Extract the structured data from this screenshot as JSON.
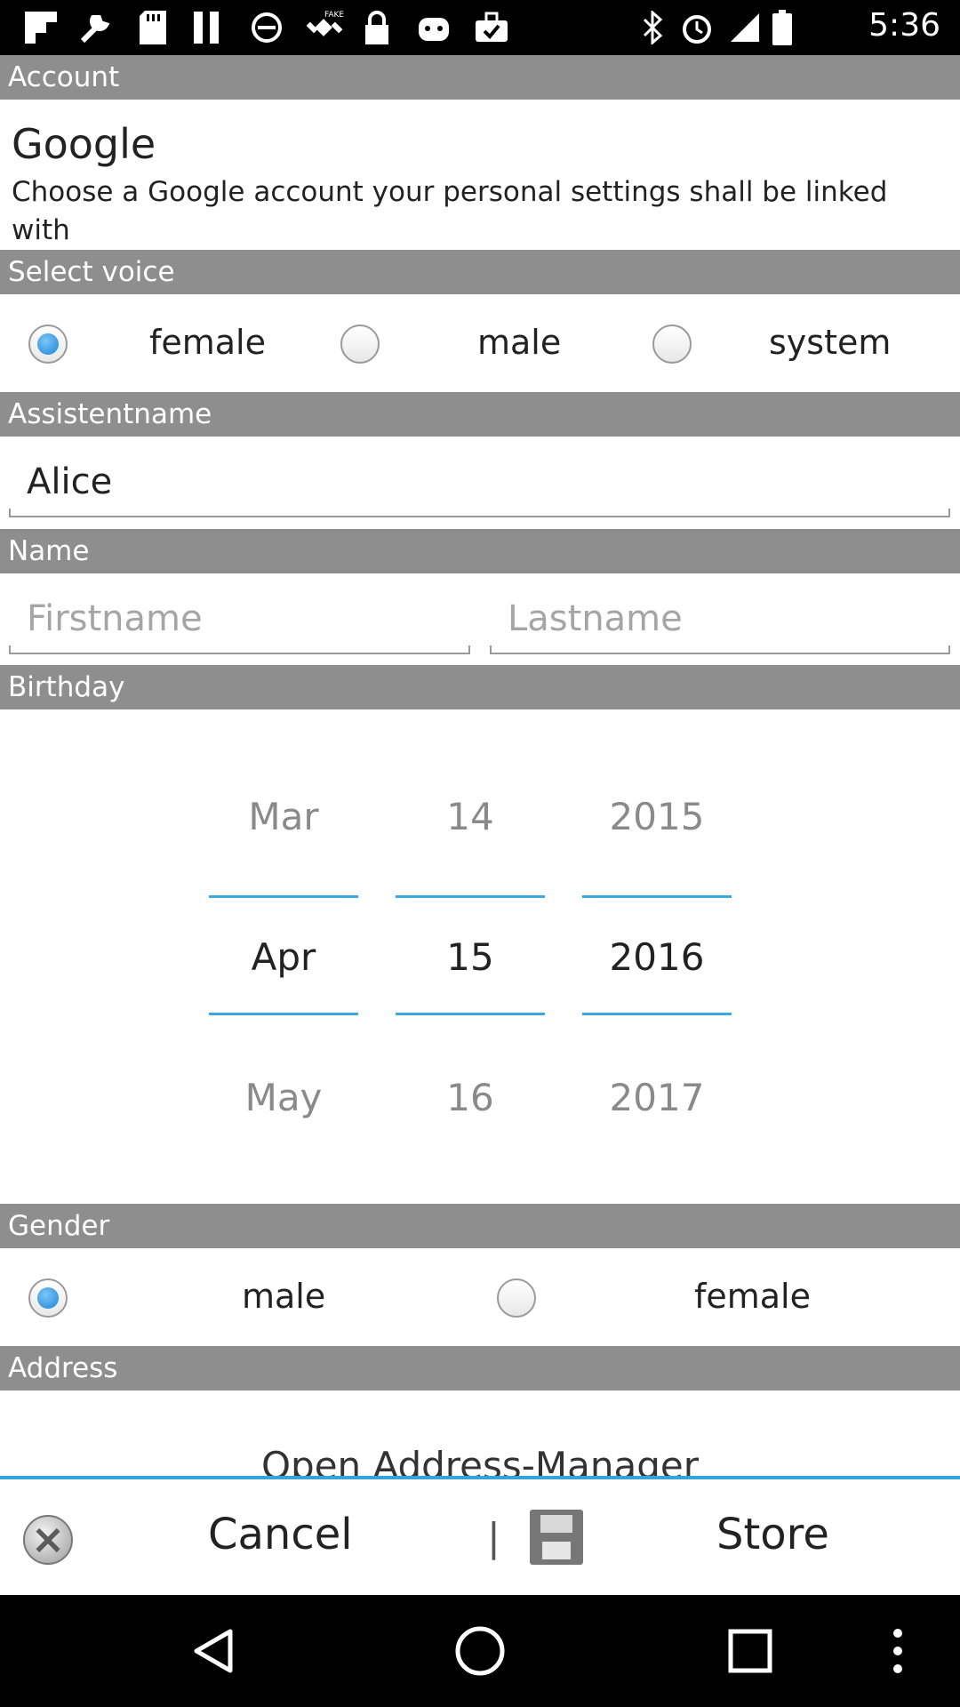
{
  "status_bar": {
    "time": "5:36",
    "left_icons": [
      "flipboard-icon",
      "wrench-icon",
      "sd-card-icon",
      "pause-icon",
      "blocked-icon",
      "fake-gps-icon",
      "lock-icon",
      "android-icon",
      "briefcase-check-icon"
    ],
    "right_icons": [
      "bluetooth-icon",
      "alarm-icon",
      "signal-icon",
      "battery-icon"
    ]
  },
  "account": {
    "header": "Account",
    "title": "Google",
    "description": "Choose a Google account your personal settings shall be linked with"
  },
  "voice": {
    "header": "Select voice",
    "options": [
      {
        "label": "female",
        "checked": true
      },
      {
        "label": "male",
        "checked": false
      },
      {
        "label": "system",
        "checked": false
      }
    ]
  },
  "assistant": {
    "header": "Assistentname",
    "value": "Alice"
  },
  "name": {
    "header": "Name",
    "firstname_placeholder": "Firstname",
    "lastname_placeholder": "Lastname"
  },
  "birthday": {
    "header": "Birthday",
    "months": {
      "prev": "Mar",
      "selected": "Apr",
      "next": "May"
    },
    "days": {
      "prev": "14",
      "selected": "15",
      "next": "16"
    },
    "years": {
      "prev": "2015",
      "selected": "2016",
      "next": "2017"
    }
  },
  "gender": {
    "header": "Gender",
    "options": [
      {
        "label": "male",
        "checked": true
      },
      {
        "label": "female",
        "checked": false
      }
    ]
  },
  "address": {
    "header": "Address",
    "button_label": "Open Address-Manager"
  },
  "actions": {
    "cancel_label": "Cancel",
    "separator": "|",
    "store_label": "Store"
  },
  "colors": {
    "header_bg": "#8e8e8e",
    "accent_blue": "#39a9e0",
    "text": "#222222"
  }
}
